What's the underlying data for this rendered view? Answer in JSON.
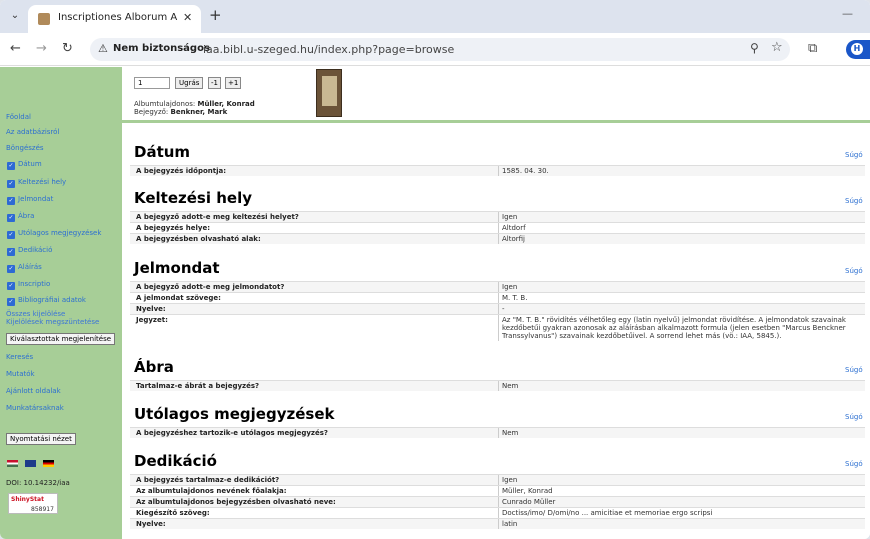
{
  "browser": {
    "tab_title": "Inscriptiones Alborum Amicorum",
    "new_tab": "+",
    "security_label": "Nem biztonságos",
    "url": "iaa.bibl.u-szeged.hu/index.php?page=browse",
    "profile_initial": "H"
  },
  "sidebar": {
    "fooldal": "Főoldal",
    "about": "Az adatbázisról",
    "browse": "Böngészés",
    "checks": [
      "Dátum",
      "Keltezési hely",
      "Jelmondat",
      "Ábra",
      "Utólagos megjegyzések",
      "Dedikáció",
      "Aláírás",
      "Inscriptio",
      "Bibliográfiai adatok"
    ],
    "select_all": "Összes kijelölése",
    "deselect_all": "Kijelölések megszüntetése",
    "show_selected": "Kiválasztottak megjelenítése",
    "search": "Keresés",
    "indexes": "Mutatók",
    "recommended": "Ajánlott oldalak",
    "contributors": "Munkatársaknak",
    "print_view": "Nyomtatási nézet",
    "doi": "DOI: 10.14232/iaa",
    "shinystat_label": "ShinyStat",
    "shinystat_count": "858917"
  },
  "header": {
    "page_value": "1",
    "go": "Ugrás",
    "prev": "-1",
    "next": "+1",
    "owner_label": "Albumtulajdonos:",
    "owner": "Müller, Konrad",
    "writer_label": "Bejegyző:",
    "writer": "Benkner, Mark"
  },
  "help": "Súgó",
  "sections": {
    "datum": {
      "title": "Dátum",
      "rows": [
        {
          "label": "A bejegyzés időpontja:",
          "value": "1585. 04. 30."
        }
      ]
    },
    "keltezes": {
      "title": "Keltezési hely",
      "rows": [
        {
          "label": "A bejegyző adott-e meg keltezési helyet?",
          "value": "Igen"
        },
        {
          "label": "A bejegyzés helye:",
          "value": "Altdorf"
        },
        {
          "label": "A bejegyzésben olvasható alak:",
          "value": "Altorfij"
        }
      ]
    },
    "jelmondat": {
      "title": "Jelmondat",
      "rows": [
        {
          "label": "A bejegyző adott-e meg jelmondatot?",
          "value": "Igen"
        },
        {
          "label": "A jelmondat szövege:",
          "value": "M. T. B."
        },
        {
          "label": "Nyelve:",
          "value": "-"
        },
        {
          "label": "Jegyzet:",
          "value": "Az \"M. T. B.\" rövidítés vélhetőleg egy (latin nyelvű) jelmondat rövidítése. A jelmondatok szavainak kezdőbetűi gyakran azonosak az aláírásban alkalmazott formula (jelen esetben \"Marcus Benckner Transsylvanus\") szavainak kezdőbetűivel. A sorrend lehet más (vö.: IAA, 5845.)."
        }
      ]
    },
    "abra": {
      "title": "Ábra",
      "rows": [
        {
          "label": "Tartalmaz-e ábrát a bejegyzés?",
          "value": "Nem"
        }
      ]
    },
    "utolagos": {
      "title": "Utólagos megjegyzések",
      "rows": [
        {
          "label": "A bejegyzéshez tartozik-e utólagos megjegyzés?",
          "value": "Nem"
        }
      ]
    },
    "dedikacio": {
      "title": "Dedikáció",
      "rows": [
        {
          "label": "A bejegyzés tartalmaz-e dedikációt?",
          "value": "Igen"
        },
        {
          "label": "Az albumtulajdonos nevének főalakja:",
          "value": "Müller, Konrad"
        },
        {
          "label": "Az albumtulajdonos bejegyzésben olvasható neve:",
          "value": "Cunrado Müller"
        },
        {
          "label": "Kiegészítő szöveg:",
          "value": "Doctiss/imo/ D/omi/no ... amicitiae et memoriae ergo scripsi"
        },
        {
          "label": "Nyelve:",
          "value": "latin"
        }
      ]
    }
  }
}
